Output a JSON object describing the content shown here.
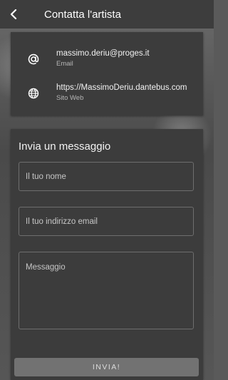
{
  "header": {
    "title": "Contatta l'artista"
  },
  "contacts": [
    {
      "value": "massimo.deriu@proges.it",
      "label": "Email",
      "icon": "at-icon"
    },
    {
      "value": "https://MassimoDeriu.dantebus.com",
      "label": "Sito Web",
      "icon": "globe-icon"
    }
  ],
  "form": {
    "heading": "Invia un messaggio",
    "name_placeholder": "Il tuo nome",
    "email_placeholder": "Il tuo indirizzo email",
    "message_placeholder": "Messaggio",
    "send_label": "INVIA!"
  },
  "colors": {
    "appbar": "#3d3d3d",
    "card": "#3c3c3c",
    "button": "#727272"
  }
}
